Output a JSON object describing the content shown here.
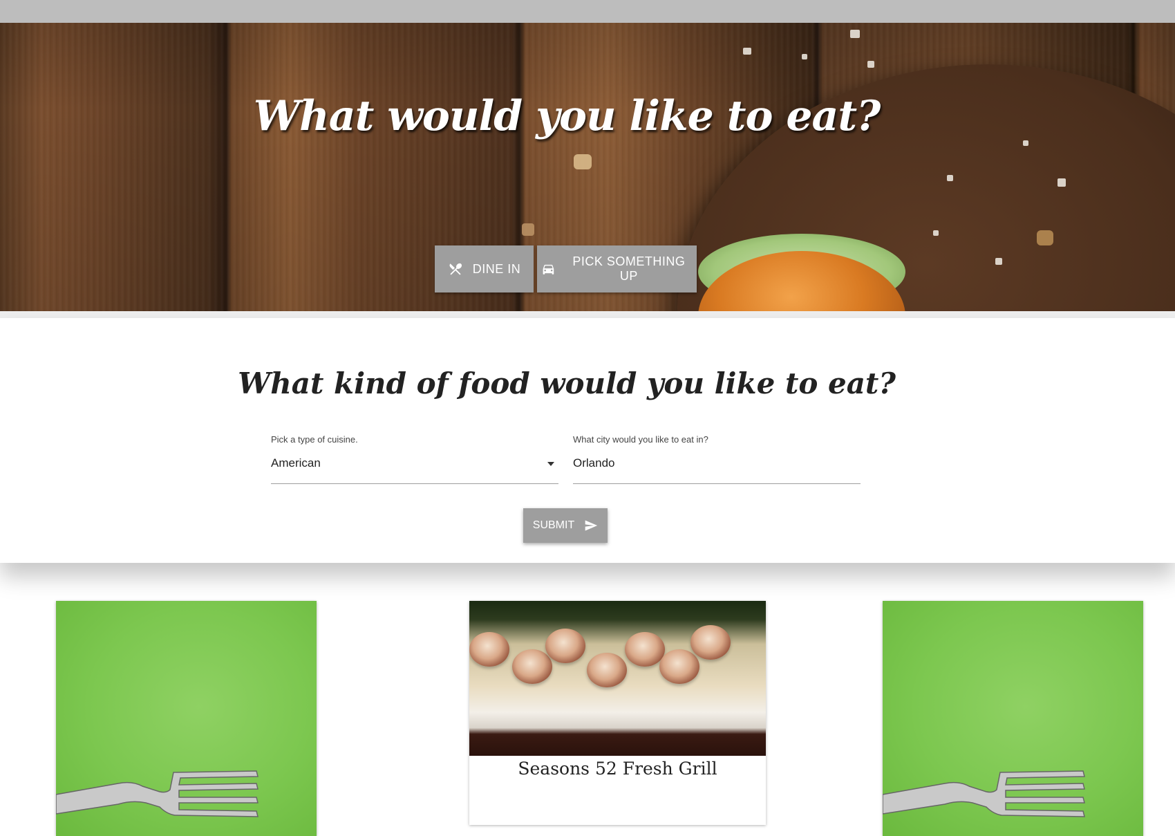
{
  "hero": {
    "title": "What would you like to eat?",
    "buttons": [
      {
        "label": "DINE IN",
        "icon": "fork-knife-icon"
      },
      {
        "label": "PICK SOMETHING UP",
        "icon": "car-icon"
      }
    ]
  },
  "search": {
    "title": "What kind of food would you like to eat?",
    "cuisine": {
      "label": "Pick a type of cuisine.",
      "value": "American"
    },
    "city": {
      "label": "What city would you like to eat in?",
      "value": "Orlando"
    },
    "submit": {
      "label": "SUBMIT",
      "icon": "send-icon"
    }
  },
  "results": [
    {
      "title": "",
      "image": "fork-on-green-image"
    },
    {
      "title": "Seasons 52 Fresh Grill",
      "image": "scallops-dish-image"
    },
    {
      "title": "",
      "image": "fork-on-green-image"
    }
  ],
  "colors": {
    "button_gray": "#9e9e9e",
    "top_bar": "#bdbdbd",
    "card_green": "#7cc74f"
  }
}
